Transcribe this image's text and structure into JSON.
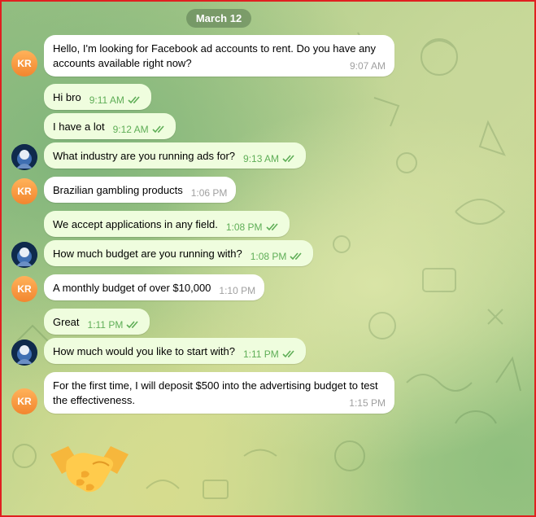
{
  "date_separator": "March 12",
  "avatars": {
    "kr_initials": "KR"
  },
  "messages": [
    {
      "text": "Hello, I'm looking for Facebook ad accounts to rent. Do you have any accounts available right now?",
      "time": "9:07 AM"
    },
    {
      "text": "Hi bro",
      "time": "9:11 AM"
    },
    {
      "text": "I have a lot",
      "time": "9:12 AM"
    },
    {
      "text": "What industry are you running ads for?",
      "time": "9:13 AM"
    },
    {
      "text": "Brazilian gambling products",
      "time": "1:06 PM"
    },
    {
      "text": "We accept applications in any field.",
      "time": "1:08 PM"
    },
    {
      "text": "How much budget are you running with?",
      "time": "1:08 PM"
    },
    {
      "text": "A monthly budget of over $10,000",
      "time": "1:10 PM"
    },
    {
      "text": "Great",
      "time": "1:11 PM"
    },
    {
      "text": "How much would you like to start with?",
      "time": "1:11 PM"
    },
    {
      "text": "For the first time, I will deposit $500 into the advertising budget to test the effectiveness.",
      "time": "1:15 PM"
    }
  ],
  "colors": {
    "incoming_bubble": "#ffffff",
    "outgoing_bubble": "#effdde",
    "read_check": "#5fae57",
    "avatar_kr": "#f2862f"
  },
  "icons": {
    "read_receipt": "double-check-icon",
    "sticker": "handshake-emoji"
  }
}
